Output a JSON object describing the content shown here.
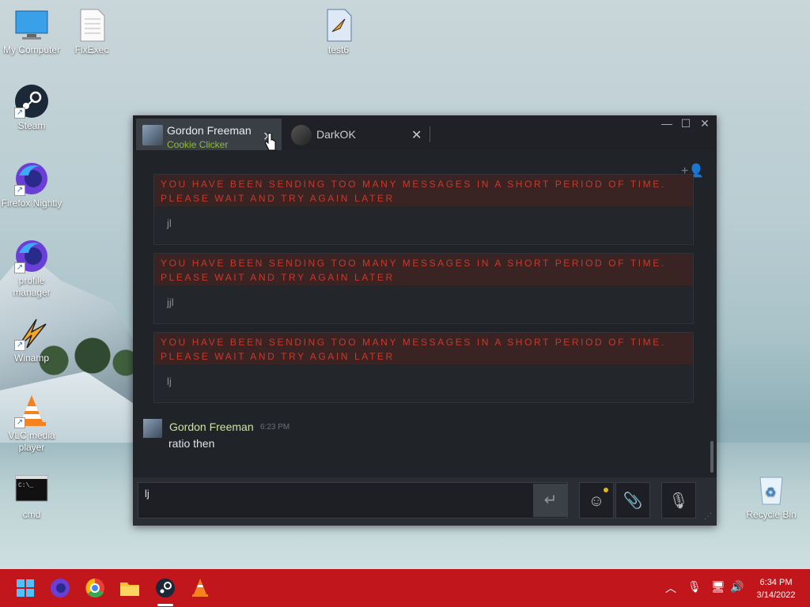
{
  "desktop": {
    "icons": [
      {
        "label": "My Computer"
      },
      {
        "label": "FixExec"
      },
      {
        "label": "test6"
      },
      {
        "label": "Steam"
      },
      {
        "label": "Firefox Nightly"
      },
      {
        "label": "profile manager"
      },
      {
        "label": "Winamp"
      },
      {
        "label": "VLC media player"
      },
      {
        "label": "cmd"
      },
      {
        "label": "Recycle Bin"
      }
    ]
  },
  "chat": {
    "tabs": [
      {
        "name": "Gordon Freeman",
        "game": "Cookie Clicker"
      },
      {
        "name": "DarkOK"
      }
    ],
    "window_buttons": {
      "minimize": "—",
      "maximize": "☐",
      "close": "✕"
    },
    "errors": [
      {
        "text": "YOU HAVE BEEN SENDING TOO MANY MESSAGES IN A SHORT PERIOD OF TIME. PLEASE WAIT AND TRY AGAIN LATER",
        "message": "jl"
      },
      {
        "text": "YOU HAVE BEEN SENDING TOO MANY MESSAGES IN A SHORT PERIOD OF TIME. PLEASE WAIT AND TRY AGAIN LATER",
        "message": "jjl"
      },
      {
        "text": "YOU HAVE BEEN SENDING TOO MANY MESSAGES IN A SHORT PERIOD OF TIME. PLEASE WAIT AND TRY AGAIN LATER",
        "message": "lj"
      }
    ],
    "last_message": {
      "sender": "Gordon Freeman",
      "time": "6:23 PM",
      "text": "ratio then"
    },
    "input": {
      "value": "lj"
    },
    "colors": {
      "error_text": "#c73a2c",
      "game_text": "#90ba3c",
      "notification_dot": "#e3b31a"
    }
  },
  "taskbar": {
    "clock": {
      "time": "6:34 PM",
      "date": "3/14/2022"
    },
    "color": "#c0161c",
    "apps": [
      "start-icon",
      "firefox-icon",
      "chrome-icon",
      "file-explorer-icon",
      "steam-icon",
      "vlc-icon"
    ]
  }
}
